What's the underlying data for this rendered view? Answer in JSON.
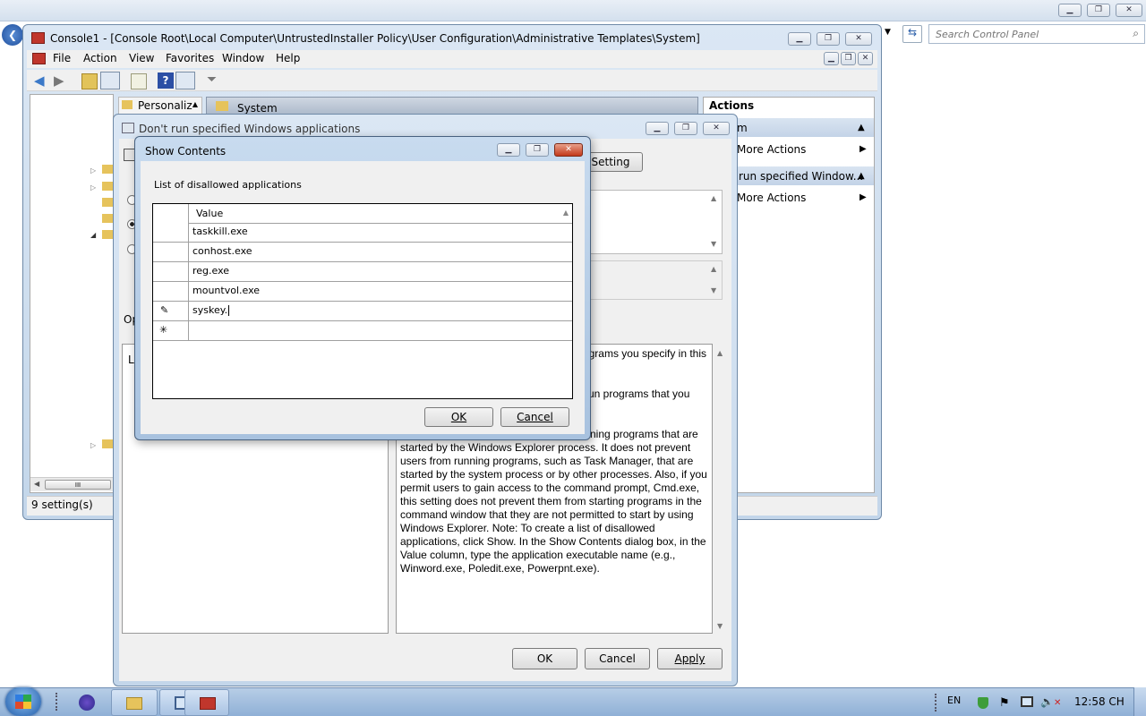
{
  "cp": {
    "search_placeholder": "Search Control Panel"
  },
  "mmc": {
    "title": "Console1 - [Console Root\\Local Computer\\UntrustedInstaller Policy\\User Configuration\\Administrative Templates\\System]",
    "menu": [
      "File",
      "Action",
      "View",
      "Favorites",
      "Window",
      "Help"
    ],
    "tree_tab": "Personaliz",
    "center_header": "System",
    "status": "9 setting(s)",
    "hscroll_label": "III",
    "actions": {
      "header": "Actions",
      "items": [
        "m",
        "More Actions",
        "run specified Window...",
        "More Actions"
      ]
    }
  },
  "policy": {
    "title": "Don't run specified Windows applications",
    "setting_btn": "Setting",
    "opt_label": "Op",
    "list_label": "Li",
    "help_lines": [
      "grams you specify in this",
      "",
      "",
      "un programs that you",
      "",
      "",
      "ning programs that are",
      "started by the Windows Explorer process. It does not prevent",
      "users from running programs, such as Task Manager, that are",
      "started by the system process or by other processes. Also, if you",
      "permit users to gain access to the command prompt, Cmd.exe,",
      "this setting does not prevent them from starting programs in the",
      "command window that they are not permitted to start by using",
      "Windows Explorer. Note: To create a list of disallowed",
      "applications, click Show. In the Show Contents dialog box, in the",
      "Value column, type the application executable name (e.g.,",
      "Winword.exe, Poledit.exe, Powerpnt.exe)."
    ],
    "ok": "OK",
    "cancel": "Cancel",
    "apply": "Apply"
  },
  "show": {
    "title": "Show Contents",
    "label": "List of disallowed applications",
    "column": "Value",
    "rows": [
      "taskkill.exe",
      "conhost.exe",
      "reg.exe",
      "mountvol.exe",
      "syskey."
    ],
    "editing_marker": "✎",
    "new_marker": "✳",
    "ok": "OK",
    "cancel": "Cancel"
  },
  "taskbar": {
    "lang": "EN",
    "clock": "12:58 CH"
  }
}
